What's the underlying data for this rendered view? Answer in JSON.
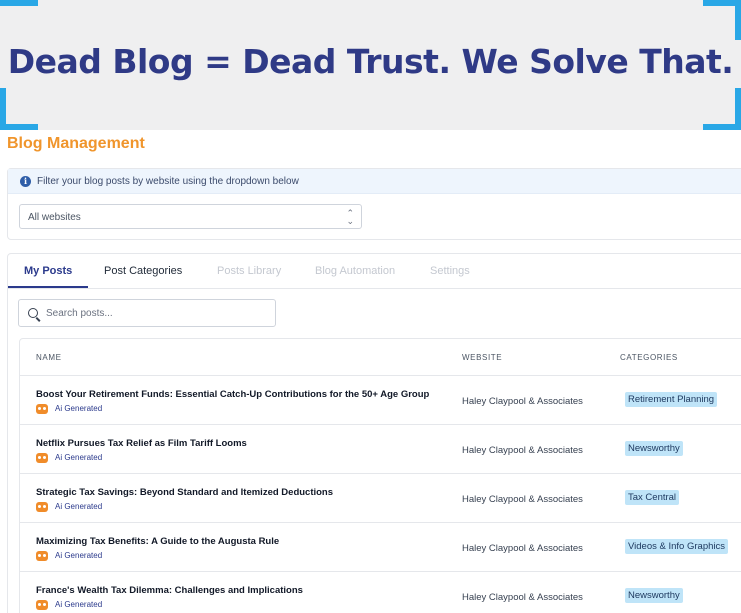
{
  "banner": {
    "title": "Dead Blog = Dead Trust. We Solve That."
  },
  "page": {
    "title": "Blog Management"
  },
  "filter": {
    "info_text": "Filter your blog posts by website using the dropdown below",
    "selected_website": "All websites"
  },
  "tabs": [
    {
      "label": "My Posts",
      "state": "active"
    },
    {
      "label": "Post Categories",
      "state": "enabled"
    },
    {
      "label": "Posts Library",
      "state": "disabled"
    },
    {
      "label": "Blog Automation",
      "state": "disabled"
    },
    {
      "label": "Settings",
      "state": "disabled"
    }
  ],
  "search": {
    "placeholder": "Search posts..."
  },
  "table": {
    "columns": [
      "NAME",
      "WEBSITE",
      "CATEGORIES"
    ],
    "rows": [
      {
        "title": "Boost Your Retirement Funds: Essential Catch-Up Contributions for the 50+ Age Group",
        "tag": "Ai Generated",
        "website": "Haley Claypool & Associates",
        "category": "Retirement Planning"
      },
      {
        "title": "Netflix Pursues Tax Relief as Film Tariff Looms",
        "tag": "Ai Generated",
        "website": "Haley Claypool & Associates",
        "category": "Newsworthy"
      },
      {
        "title": "Strategic Tax Savings: Beyond Standard and Itemized Deductions",
        "tag": "Ai Generated",
        "website": "Haley Claypool & Associates",
        "category": "Tax Central"
      },
      {
        "title": "Maximizing Tax Benefits: A Guide to the Augusta Rule",
        "tag": "Ai Generated",
        "website": "Haley Claypool & Associates",
        "category": "Videos & Info Graphics"
      },
      {
        "title": "France's Wealth Tax Dilemma: Challenges and Implications",
        "tag": "Ai Generated",
        "website": "Haley Claypool & Associates",
        "category": "Newsworthy"
      }
    ]
  },
  "colors": {
    "brand_orange": "#f0952c",
    "banner_text": "#2f3a86",
    "corner_accent": "#29a7e6",
    "active_tab": "#2b3a8c",
    "category_badge": "#bfe4f8"
  }
}
